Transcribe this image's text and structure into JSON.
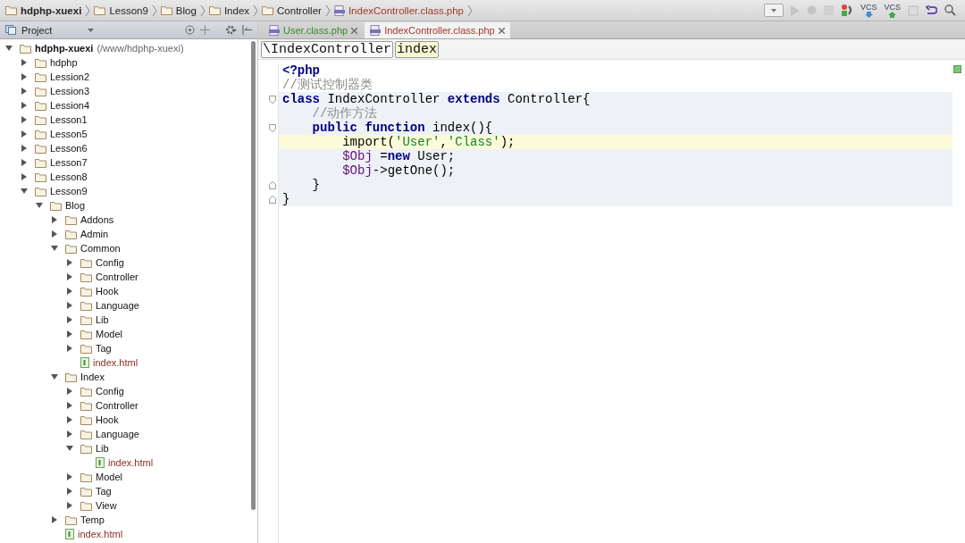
{
  "breadcrumbs": [
    {
      "label": "hdphp-xuexi",
      "kind": "root"
    },
    {
      "label": "Lesson9",
      "kind": "folder"
    },
    {
      "label": "Blog",
      "kind": "folder"
    },
    {
      "label": "Index",
      "kind": "folder"
    },
    {
      "label": "Controller",
      "kind": "folder"
    },
    {
      "label": "IndexController.class.php",
      "kind": "file"
    }
  ],
  "toolbar": {
    "vcs_labels": [
      "VCS",
      "VCS"
    ]
  },
  "project_panel": {
    "title": "Project",
    "tree": [
      {
        "label": "hdphp-xuexi",
        "path": "(/www/hdphp-xuexi)",
        "kind": "folder",
        "expanded": true,
        "children": [
          {
            "label": "hdphp",
            "kind": "folder",
            "expanded": false
          },
          {
            "label": "Lession2",
            "kind": "folder",
            "expanded": false
          },
          {
            "label": "Lession3",
            "kind": "folder",
            "expanded": false
          },
          {
            "label": "Lession4",
            "kind": "folder",
            "expanded": false
          },
          {
            "label": "Lesson1",
            "kind": "folder",
            "expanded": false
          },
          {
            "label": "Lesson5",
            "kind": "folder",
            "expanded": false
          },
          {
            "label": "Lesson6",
            "kind": "folder",
            "expanded": false
          },
          {
            "label": "Lesson7",
            "kind": "folder",
            "expanded": false
          },
          {
            "label": "Lesson8",
            "kind": "folder",
            "expanded": false
          },
          {
            "label": "Lesson9",
            "kind": "folder",
            "expanded": true,
            "children": [
              {
                "label": "Blog",
                "kind": "folder",
                "expanded": true,
                "children": [
                  {
                    "label": "Addons",
                    "kind": "folder",
                    "expanded": false
                  },
                  {
                    "label": "Admin",
                    "kind": "folder",
                    "expanded": false
                  },
                  {
                    "label": "Common",
                    "kind": "folder",
                    "expanded": true,
                    "children": [
                      {
                        "label": "Config",
                        "kind": "folder",
                        "expanded": false
                      },
                      {
                        "label": "Controller",
                        "kind": "folder",
                        "expanded": false
                      },
                      {
                        "label": "Hook",
                        "kind": "folder",
                        "expanded": false
                      },
                      {
                        "label": "Language",
                        "kind": "folder",
                        "expanded": false
                      },
                      {
                        "label": "Lib",
                        "kind": "folder",
                        "expanded": false
                      },
                      {
                        "label": "Model",
                        "kind": "folder",
                        "expanded": false
                      },
                      {
                        "label": "Tag",
                        "kind": "folder",
                        "expanded": false
                      },
                      {
                        "label": "index.html",
                        "kind": "file"
                      }
                    ]
                  },
                  {
                    "label": "Index",
                    "kind": "folder",
                    "expanded": true,
                    "children": [
                      {
                        "label": "Config",
                        "kind": "folder",
                        "expanded": false
                      },
                      {
                        "label": "Controller",
                        "kind": "folder",
                        "expanded": false
                      },
                      {
                        "label": "Hook",
                        "kind": "folder",
                        "expanded": false
                      },
                      {
                        "label": "Language",
                        "kind": "folder",
                        "expanded": false
                      },
                      {
                        "label": "Lib",
                        "kind": "folder",
                        "expanded": true,
                        "children": [
                          {
                            "label": "index.html",
                            "kind": "file"
                          }
                        ]
                      },
                      {
                        "label": "Model",
                        "kind": "folder",
                        "expanded": false
                      },
                      {
                        "label": "Tag",
                        "kind": "folder",
                        "expanded": false
                      },
                      {
                        "label": "View",
                        "kind": "folder",
                        "expanded": false
                      }
                    ]
                  },
                  {
                    "label": "Temp",
                    "kind": "folder",
                    "expanded": false
                  },
                  {
                    "label": "index.html",
                    "kind": "file"
                  }
                ]
              }
            ]
          }
        ]
      }
    ]
  },
  "tabs": [
    {
      "label": "User.class.php",
      "selected": false,
      "modified": false
    },
    {
      "label": "IndexController.class.php",
      "selected": true,
      "modified": true
    }
  ],
  "editor": {
    "path": [
      "\\IndexController",
      "index"
    ],
    "lines": [
      {
        "current": false,
        "block": false,
        "fold_start": false,
        "fold_end": false,
        "tokens": [
          {
            "kind": "tag",
            "text": "<?php"
          }
        ]
      },
      {
        "current": false,
        "block": false,
        "fold_start": false,
        "fold_end": false,
        "tokens": [
          {
            "kind": "comment",
            "text": "//测试控制器类"
          }
        ]
      },
      {
        "current": false,
        "block": true,
        "fold_start": true,
        "fold_end": false,
        "tokens": [
          {
            "kind": "keyword",
            "text": "class"
          },
          {
            "kind": "plain",
            "text": " IndexController "
          },
          {
            "kind": "keyword",
            "text": "extends"
          },
          {
            "kind": "plain",
            "text": " Controller{"
          }
        ]
      },
      {
        "current": false,
        "block": true,
        "fold_start": false,
        "fold_end": false,
        "tokens": [
          {
            "kind": "comment",
            "text": "    //动作方法"
          }
        ]
      },
      {
        "current": false,
        "block": true,
        "fold_start": true,
        "fold_end": false,
        "tokens": [
          {
            "kind": "keyword",
            "text": "    public function"
          },
          {
            "kind": "plain",
            "text": " index(){"
          }
        ]
      },
      {
        "current": true,
        "block": true,
        "fold_start": false,
        "fold_end": false,
        "tokens": [
          {
            "kind": "plain",
            "text": "        import("
          },
          {
            "kind": "string",
            "text": "'User'"
          },
          {
            "kind": "plain",
            "text": ","
          },
          {
            "kind": "string",
            "text": "'Class'"
          },
          {
            "kind": "plain",
            "text": ");"
          }
        ]
      },
      {
        "current": false,
        "block": true,
        "fold_start": false,
        "fold_end": false,
        "tokens": [
          {
            "kind": "variable",
            "text": "        $Obj"
          },
          {
            "kind": "plain",
            "text": " ="
          },
          {
            "kind": "keyword",
            "text": "new"
          },
          {
            "kind": "plain",
            "text": " User;"
          }
        ]
      },
      {
        "current": false,
        "block": true,
        "fold_start": false,
        "fold_end": false,
        "tokens": [
          {
            "kind": "variable",
            "text": "        $Obj"
          },
          {
            "kind": "plain",
            "text": "->getOne();"
          }
        ]
      },
      {
        "current": false,
        "block": true,
        "fold_start": false,
        "fold_end": true,
        "tokens": [
          {
            "kind": "plain",
            "text": "    }"
          }
        ]
      },
      {
        "current": false,
        "block": true,
        "fold_start": false,
        "fold_end": true,
        "tokens": [
          {
            "kind": "plain",
            "text": "}"
          }
        ]
      }
    ]
  }
}
